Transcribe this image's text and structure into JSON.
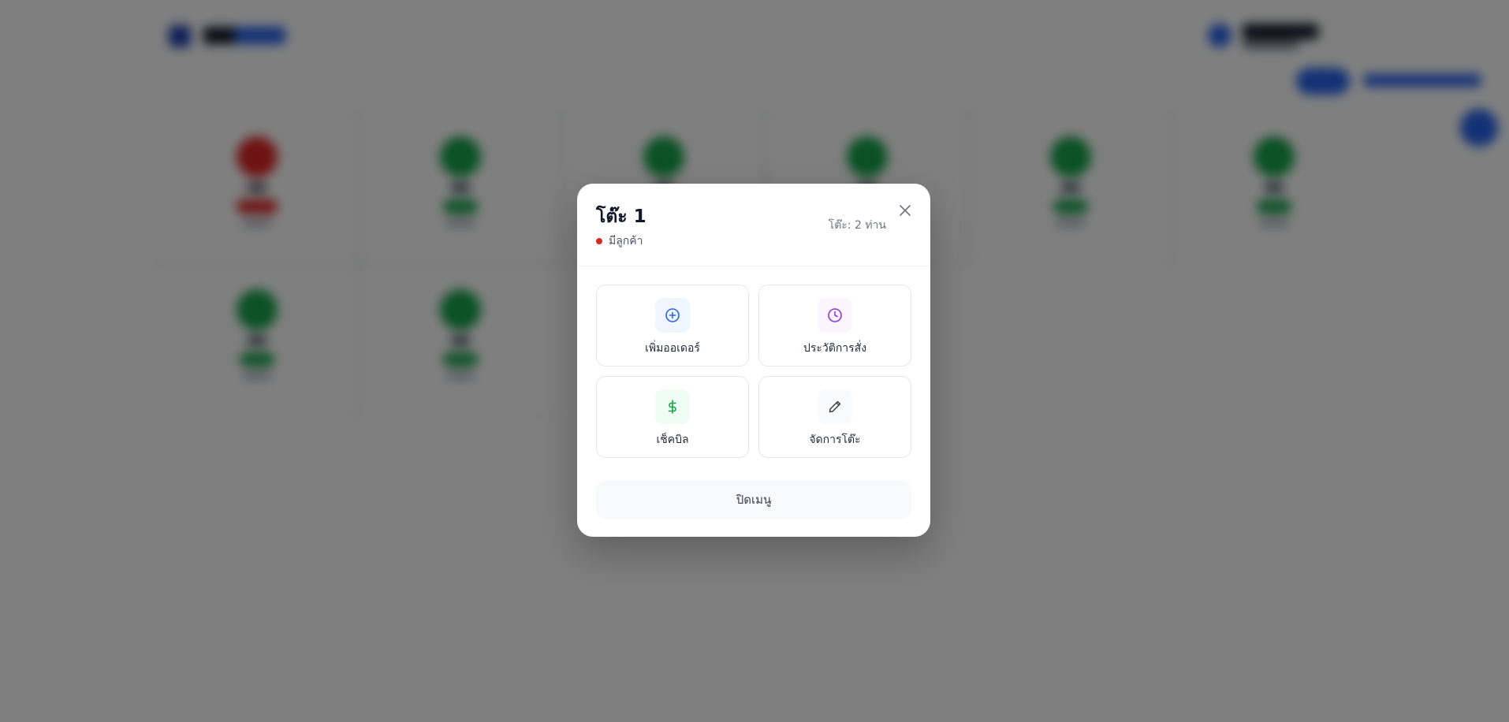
{
  "background": {
    "header": {
      "logo_icon": "grid-icon"
    },
    "tables": [
      {
        "status": "occupied"
      },
      {
        "status": "available"
      },
      {
        "status": "available"
      },
      {
        "status": "available"
      },
      {
        "status": "available"
      },
      {
        "status": "available"
      },
      {
        "status": "available"
      },
      {
        "status": "available"
      }
    ]
  },
  "modal": {
    "title": "โต๊ะ 1",
    "status_text": "มีลูกค้า",
    "status_color": "#dc2626",
    "seats": "โต๊ะ: 2 ท่าน",
    "close_icon": "close-icon",
    "actions": [
      {
        "label": "เพิ่มออเดอร์",
        "icon": "plus-circle-icon",
        "icon_color": "#2563eb",
        "icon_bg": "#eff6ff"
      },
      {
        "label": "ประวัติการสั่ง",
        "icon": "clock-icon",
        "icon_color": "#9333ea",
        "icon_bg": "#faf5ff"
      },
      {
        "label": "เช็คบิล",
        "icon": "dollar-icon",
        "icon_color": "#16a34a",
        "icon_bg": "#f0fdf4"
      },
      {
        "label": "จัดการโต๊ะ",
        "icon": "pencil-icon",
        "icon_color": "#374151",
        "icon_bg": "#f9fafb"
      }
    ],
    "close_menu_label": "ปิดเมนู"
  }
}
